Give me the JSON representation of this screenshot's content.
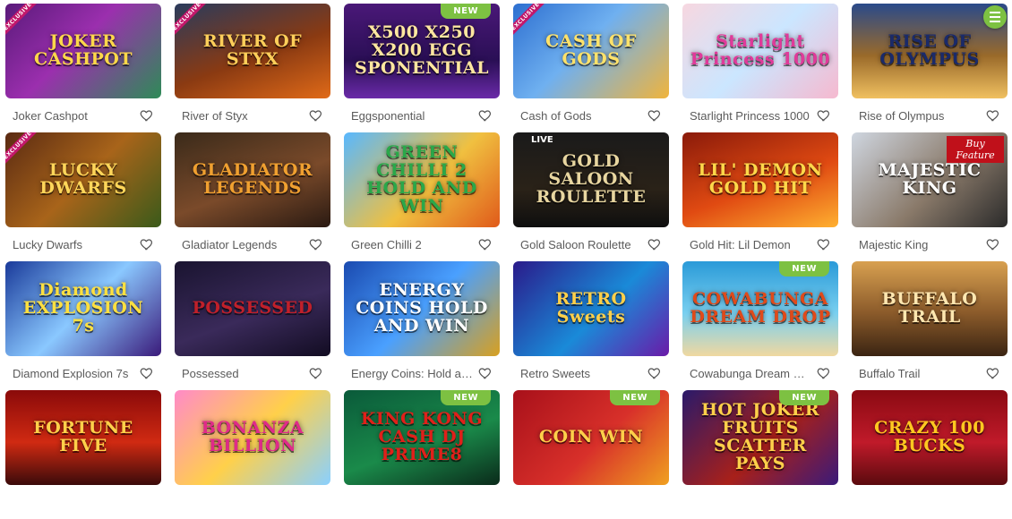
{
  "ui": {
    "heart_icon_color": "#555555",
    "accent_green": "#7dc142"
  },
  "games": [
    {
      "title": "Joker Cashpot",
      "logo": "JOKER CASHPOT",
      "badge": "EXCLUSIVE",
      "bg": "linear-gradient(135deg,#5a1a7a,#9b2fae 45%,#2e8b57)",
      "fg": "#ffd84a"
    },
    {
      "title": "River of Styx",
      "logo": "RIVER OF STYX",
      "badge": "EXCLUSIVE",
      "bg": "linear-gradient(160deg,#2a3b5c,#8a3a12 55%,#e06a18)",
      "fg": "#ffcf5a"
    },
    {
      "title": "Eggsponential",
      "logo": "X500 X250 X200 EGG SPONENTIAL",
      "badge": "NEW",
      "bg": "linear-gradient(180deg,#4a1878,#2a0f55 60%,#6a2aa8)",
      "fg": "#ffe7a0"
    },
    {
      "title": "Cash of Gods",
      "logo": "CASH OF GODS",
      "badge": "EXCLUSIVE",
      "bg": "linear-gradient(135deg,#2d6fd0,#6fb0f0 45%,#f0b43c)",
      "fg": "#ffe26a"
    },
    {
      "title": "Starlight Princess 1000",
      "logo": "Starlight Princess 1000",
      "badge": "",
      "bg": "linear-gradient(135deg,#f7d7e0,#cbe6ff 50%,#f6b9cf)",
      "fg": "#e03a9a"
    },
    {
      "title": "Rise of Olympus",
      "logo": "RISE OF OLYMPUS",
      "badge": "",
      "bg": "linear-gradient(180deg,#2a4a8a,#9a6a2a 55%,#f0c060)",
      "fg": "#1a2a6a"
    },
    {
      "title": "Lucky Dwarfs",
      "logo": "LUCKY DWARFS",
      "badge": "EXCLUSIVE",
      "bg": "linear-gradient(135deg,#5a2a12,#a8641a 50%,#3a5a1a)",
      "fg": "#ffd65a"
    },
    {
      "title": "Gladiator Legends",
      "logo": "GLADIATOR LEGENDS",
      "badge": "",
      "bg": "linear-gradient(160deg,#3a2a1a,#7a4a2a 55%,#2a1a12)",
      "fg": "#f0a030"
    },
    {
      "title": "Green Chilli 2",
      "logo": "GREEN CHILLI 2 HOLD AND WIN",
      "badge": "",
      "bg": "linear-gradient(135deg,#58b8ff,#f0c040 55%,#e05a1a)",
      "fg": "#2aa84a"
    },
    {
      "title": "Gold Saloon Roulette",
      "logo": "GOLD SALOON ROULETTE",
      "badge": "LIVE",
      "bg": "linear-gradient(180deg,#1a1a1a,#2a2218 60%,#0e0e0e)",
      "fg": "#e8d6a0"
    },
    {
      "title": "Gold Hit: Lil Demon",
      "logo": "LIL' DEMON GOLD HIT",
      "badge": "",
      "bg": "linear-gradient(160deg,#8a1a0a,#e04a12 55%,#ffb030)",
      "fg": "#ffd84a"
    },
    {
      "title": "Majestic King",
      "logo": "MAJESTIC KING",
      "badge": "Buy Feature",
      "bg": "linear-gradient(135deg,#cfd6e0,#8a7a6a 55%,#2a2a2a)",
      "fg": "#ffffff"
    },
    {
      "title": "Diamond Explosion 7s",
      "logo": "Diamond EXPLOSION 7s",
      "badge": "",
      "bg": "linear-gradient(135deg,#1a3a9a,#8ac8ff 50%,#3a1a7a)",
      "fg": "#ffe040"
    },
    {
      "title": "Possessed",
      "logo": "POSSESSED",
      "badge": "",
      "bg": "linear-gradient(160deg,#1a1430,#3a2a5a 55%,#120c22)",
      "fg": "#c0202a"
    },
    {
      "title": "Energy Coins: Hold and Win",
      "logo": "ENERGY COINS HOLD AND WIN",
      "badge": "",
      "bg": "linear-gradient(135deg,#1a4ab0,#4aa0ff 50%,#d8a020)",
      "fg": "#ffffff"
    },
    {
      "title": "Retro Sweets",
      "logo": "RETRO Sweets",
      "badge": "",
      "bg": "linear-gradient(135deg,#2a1a8a,#1a8ad8 55%,#6a1aa8)",
      "fg": "#ffd04a"
    },
    {
      "title": "Cowabunga Dream Drop",
      "logo": "COWABUNGA DREAM DROP",
      "badge": "NEW",
      "bg": "linear-gradient(180deg,#2a9ad8,#7ad0f0 55%,#f0d8a0)",
      "fg": "#e04a1a"
    },
    {
      "title": "Buffalo Trail",
      "logo": "BUFFALO TRAIL",
      "badge": "",
      "bg": "linear-gradient(180deg,#d8a050,#8a5a2a 55%,#3a2412)",
      "fg": "#ffe7b0"
    },
    {
      "title": "",
      "logo": "FORTUNE FIVE",
      "badge": "",
      "bg": "linear-gradient(180deg,#8a0a0a,#d02a12 55%,#3a0a0a)",
      "fg": "#ffd04a"
    },
    {
      "title": "",
      "logo": "BONANZA BILLION",
      "badge": "",
      "bg": "linear-gradient(135deg,#ff8ac8,#ffd04a 50%,#8ad0ff)",
      "fg": "#e02a8a"
    },
    {
      "title": "",
      "logo": "KING KONG CASH DJ PRIME8",
      "badge": "NEW",
      "bg": "linear-gradient(160deg,#0a5a3a,#1a8a4a 55%,#0a2a1a)",
      "fg": "#e0201a"
    },
    {
      "title": "",
      "logo": "COIN WIN",
      "badge": "NEW",
      "bg": "linear-gradient(135deg,#a8101a,#d8302a 55%,#f0a020)",
      "fg": "#ffd04a"
    },
    {
      "title": "",
      "logo": "HOT JOKER FRUITS SCATTER PAYS",
      "badge": "NEW",
      "bg": "linear-gradient(135deg,#2a1a6a,#a8201a 55%,#3a1a7a)",
      "fg": "#ffd04a"
    },
    {
      "title": "",
      "logo": "CRAZY 100 BUCKS",
      "badge": "",
      "bg": "linear-gradient(180deg,#8a0a12,#c01a2a 55%,#5a0a0e)",
      "fg": "#ffc820"
    }
  ]
}
